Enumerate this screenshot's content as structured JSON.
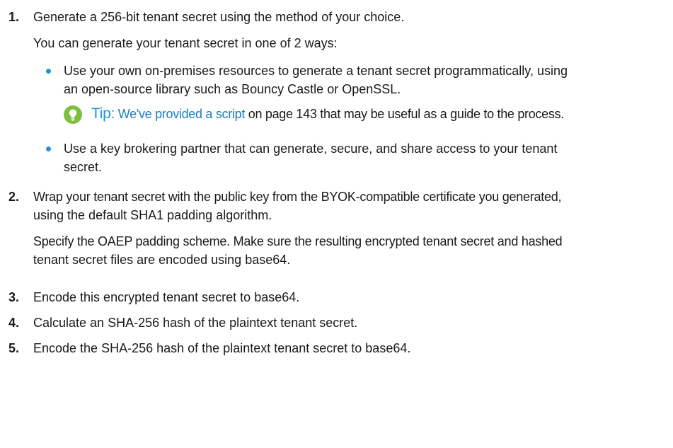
{
  "accent_color": "#1b96d2",
  "tip_icon_color": "#7fbf3f",
  "steps": [
    {
      "number": "1.",
      "text": "Generate a 256-bit tenant secret using the method of your choice.",
      "para": "You can generate your tenant secret in one of 2 ways:",
      "bullets": [
        {
          "line1": "Use your own on-premises resources to generate a tenant secret programmatically, using",
          "line2": "an open-source library such as Bouncy Castle or OpenSSL."
        },
        {
          "line1": "Use a key brokering partner that can generate, secure, and share access to your tenant",
          "line2": "secret."
        }
      ],
      "tip": {
        "icon": "lightbulb-icon",
        "label": "Tip",
        "colon": ":",
        "link_text": "We've provided a script",
        "rest": " on page 143 that may be useful as a guide to the process."
      }
    },
    {
      "number": "2.",
      "line1": "Wrap your tenant secret with the public key from the BYOK-compatible certificate you generated,",
      "line2": "using the default SHA1 padding algorithm.",
      "para_line1": "Specify the OAEP padding scheme. Make sure the resulting encrypted tenant secret and hashed",
      "para_line2": "tenant secret files are encoded using base64."
    },
    {
      "number": "3.",
      "text": "Encode this encrypted tenant secret to base64."
    },
    {
      "number": "4.",
      "text": "Calculate an SHA-256 hash of the plaintext tenant secret."
    },
    {
      "number": "5.",
      "text": "Encode the SHA-256 hash of the plaintext tenant secret to base64."
    }
  ]
}
